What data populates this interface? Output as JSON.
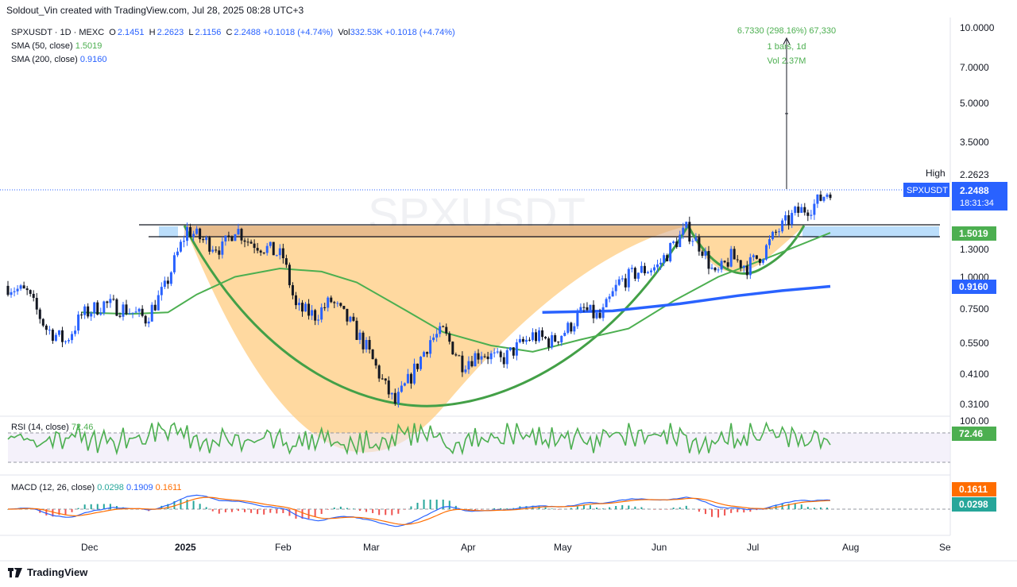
{
  "header": {
    "attribution": "Soldout_Vin created with TradingView.com, Jul 28, 2025 08:28 UTC+3"
  },
  "legend": {
    "symbol": "SPXUSDT · 1D · MEXC",
    "o_label": "O",
    "o": "2.1451",
    "h_label": "H",
    "h": "2.2623",
    "l_label": "L",
    "l": "2.1156",
    "c_label": "C",
    "c": "2.2488",
    "chg": "+0.1018 (+4.74%)",
    "vol_label": "Vol",
    "vol": "332.53K",
    "vol_chg": "+0.1018 (+4.74%)",
    "sma50_label": "SMA (50, close)",
    "sma50": "1.5019",
    "sma200_label": "SMA (200, close)",
    "sma200": "0.9160"
  },
  "measure": {
    "line1": "6.7330 (298.16%) 67,330",
    "line2": "1 bars, 1d",
    "line3": "Vol 2.37M"
  },
  "watermark": "SPXUSDT",
  "price_axis": {
    "ticks": [
      "10.0000",
      "7.0000",
      "5.0000",
      "3.5000",
      "1.3000",
      "1.0000",
      "0.7500",
      "0.5500",
      "0.4100",
      "0.3100"
    ],
    "high_label": "High",
    "high_value": "2.2623",
    "symbol_tag": "SPXUSDT",
    "last_price": "2.2488",
    "countdown": "18:31:34",
    "sma50_tag": "1.5019",
    "sma200_tag": "0.9160"
  },
  "time_axis": [
    "Dec",
    "2025",
    "Feb",
    "Mar",
    "Apr",
    "May",
    "Jun",
    "Jul",
    "Aug",
    "Se"
  ],
  "rsi": {
    "label": "RSI (14, close)",
    "value": "72.46",
    "top_tick": "100.00",
    "tag": "72.46"
  },
  "macd": {
    "label": "MACD (12, 26, close)",
    "hist": "0.0298",
    "macd": "0.1909",
    "signal": "0.1611",
    "tag_signal": "0.1611",
    "tag_hist": "0.0298"
  },
  "footer": {
    "brand": "TradingView"
  },
  "colors": {
    "up": "#2962ff",
    "down": "#131722",
    "sma50": "#4caf50",
    "sma200": "#2962ff",
    "cup": "#ffcc80",
    "rsi": "#4caf50",
    "macd": "#2962ff",
    "signal": "#ff6d00",
    "hist_up": "#26a69a",
    "hist_down": "#ef5350"
  },
  "chart_data": {
    "type": "candlestick",
    "symbol": "SPXUSDT",
    "timeframe": "1D",
    "y_scale": "log",
    "ylim": [
      0.29,
      10.5
    ],
    "x_range": [
      "2024-11-12",
      "2025-09-01"
    ],
    "last_close": 2.2488,
    "sma50_last": 1.5019,
    "sma200_last": 0.916,
    "resistance_zone": [
      1.42,
      1.62
    ],
    "price_path": [
      [
        "2024-11-12",
        0.92
      ],
      [
        "2024-11-18",
        0.86
      ],
      [
        "2024-11-24",
        0.62
      ],
      [
        "2024-11-30",
        0.55
      ],
      [
        "2024-12-05",
        0.7
      ],
      [
        "2024-12-12",
        0.78
      ],
      [
        "2024-12-19",
        0.74
      ],
      [
        "2024-12-25",
        0.68
      ],
      [
        "2024-12-31",
        0.9
      ],
      [
        "2025-01-03",
        1.15
      ],
      [
        "2025-01-07",
        1.55
      ],
      [
        "2025-01-12",
        1.4
      ],
      [
        "2025-01-18",
        1.3
      ],
      [
        "2025-01-22",
        1.58
      ],
      [
        "2025-01-26",
        1.4
      ],
      [
        "2025-02-01",
        1.3
      ],
      [
        "2025-02-06",
        1.2
      ],
      [
        "2025-02-10",
        0.75
      ],
      [
        "2025-02-16",
        0.7
      ],
      [
        "2025-02-21",
        0.8
      ],
      [
        "2025-02-27",
        0.65
      ],
      [
        "2025-03-04",
        0.52
      ],
      [
        "2025-03-10",
        0.36
      ],
      [
        "2025-03-13",
        0.31
      ],
      [
        "2025-03-18",
        0.4
      ],
      [
        "2025-03-24",
        0.56
      ],
      [
        "2025-03-28",
        0.6
      ],
      [
        "2025-04-03",
        0.45
      ],
      [
        "2025-04-09",
        0.5
      ],
      [
        "2025-04-15",
        0.46
      ],
      [
        "2025-04-20",
        0.52
      ],
      [
        "2025-04-25",
        0.58
      ],
      [
        "2025-05-01",
        0.55
      ],
      [
        "2025-05-06",
        0.62
      ],
      [
        "2025-05-11",
        0.74
      ],
      [
        "2025-05-16",
        0.68
      ],
      [
        "2025-05-22",
        0.95
      ],
      [
        "2025-05-28",
        1.05
      ],
      [
        "2025-06-03",
        1.1
      ],
      [
        "2025-06-08",
        1.35
      ],
      [
        "2025-06-12",
        1.55
      ],
      [
        "2025-06-17",
        1.3
      ],
      [
        "2025-06-21",
        1.0
      ],
      [
        "2025-06-26",
        1.2
      ],
      [
        "2025-07-01",
        1.1
      ],
      [
        "2025-07-06",
        1.25
      ],
      [
        "2025-07-10",
        1.5
      ],
      [
        "2025-07-16",
        1.8
      ],
      [
        "2025-07-22",
        1.95
      ],
      [
        "2025-07-27",
        2.2488
      ]
    ],
    "sma50": [
      [
        "2024-12-05",
        0.72
      ],
      [
        "2024-12-20",
        0.71
      ],
      [
        "2025-01-01",
        0.72
      ],
      [
        "2025-01-10",
        0.85
      ],
      [
        "2025-01-22",
        1.0
      ],
      [
        "2025-02-05",
        1.08
      ],
      [
        "2025-02-18",
        1.05
      ],
      [
        "2025-03-01",
        0.95
      ],
      [
        "2025-03-15",
        0.75
      ],
      [
        "2025-03-28",
        0.6
      ],
      [
        "2025-04-12",
        0.53
      ],
      [
        "2025-04-25",
        0.5
      ],
      [
        "2025-05-10",
        0.56
      ],
      [
        "2025-05-25",
        0.62
      ],
      [
        "2025-06-08",
        0.8
      ],
      [
        "2025-06-22",
        1.0
      ],
      [
        "2025-07-08",
        1.2
      ],
      [
        "2025-07-27",
        1.5019
      ]
    ],
    "sma200": [
      [
        "2025-04-28",
        0.72
      ],
      [
        "2025-05-20",
        0.73
      ],
      [
        "2025-06-10",
        0.78
      ],
      [
        "2025-06-28",
        0.84
      ],
      [
        "2025-07-12",
        0.88
      ],
      [
        "2025-07-27",
        0.916
      ]
    ],
    "rsi": {
      "ylim": [
        0,
        100
      ],
      "last": 72.46
    },
    "macd": {
      "macd": 0.1909,
      "signal": 0.1611,
      "histogram": 0.0298
    }
  }
}
